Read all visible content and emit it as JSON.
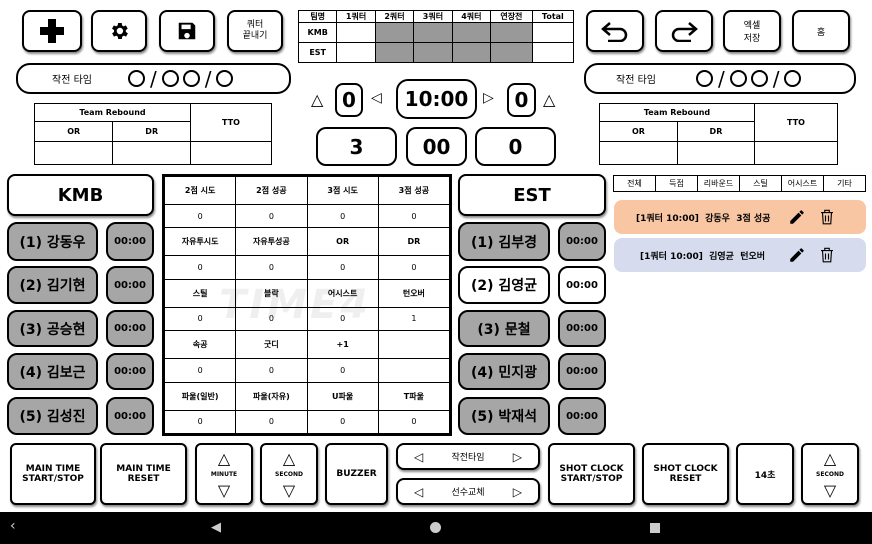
{
  "toolbar": {
    "add_icon": "plus-icon",
    "settings_icon": "gear-icon",
    "save_icon": "floppy-icon",
    "quarter_end_label": "쿼터\n끝내기",
    "undo_icon": "undo-icon",
    "redo_icon": "redo-icon",
    "excel_label": "엑셀\n저장",
    "home_label": "홈"
  },
  "quarter_table": {
    "headers": [
      "팀명",
      "1쿼터",
      "2쿼터",
      "3쿼터",
      "4쿼터",
      "연장전",
      "Total"
    ],
    "rows": [
      {
        "team": "KMB",
        "values": [
          "",
          "",
          "",
          "",
          "",
          ""
        ]
      },
      {
        "team": "EST",
        "values": [
          "",
          "",
          "",
          "",
          "",
          ""
        ]
      }
    ]
  },
  "left": {
    "timeout_label": "작전 타임",
    "team_rebound_label": "Team Rebound",
    "or_label": "OR",
    "dr_label": "DR",
    "tto_label": "TTO",
    "team_name": "KMB",
    "players": [
      {
        "name": "(1) 강동우",
        "time": "00:00"
      },
      {
        "name": "(2) 김기현",
        "time": "00:00"
      },
      {
        "name": "(3) 공승현",
        "time": "00:00"
      },
      {
        "name": "(4) 김보근",
        "time": "00:00"
      },
      {
        "name": "(5) 김성진",
        "time": "00:00"
      }
    ]
  },
  "right": {
    "timeout_label": "작전 타임",
    "team_rebound_label": "Team Rebound",
    "or_label": "OR",
    "dr_label": "DR",
    "tto_label": "TTO",
    "team_name": "EST",
    "players": [
      {
        "name": "(1) 김부경",
        "time": "00:00"
      },
      {
        "name": "(2) 김영균",
        "time": "00:00"
      },
      {
        "name": "(3) 문철",
        "time": "00:00"
      },
      {
        "name": "(4) 민지광",
        "time": "00:00"
      },
      {
        "name": "(5) 박재석",
        "time": "00:00"
      }
    ]
  },
  "scoreboard": {
    "left_foul": "0",
    "main_time": "10:00",
    "right_foul": "0",
    "left_score": "3",
    "shot_clock": "00",
    "right_score": "0"
  },
  "stats": {
    "rows": [
      {
        "labels": [
          "2점 시도",
          "2점 성공",
          "3점 시도",
          "3점 성공"
        ],
        "values": [
          "0",
          "0",
          "0",
          "0"
        ]
      },
      {
        "labels": [
          "자유투시도",
          "자유투성공",
          "OR",
          "DR"
        ],
        "values": [
          "0",
          "0",
          "0",
          "0"
        ]
      },
      {
        "labels": [
          "스틸",
          "블락",
          "어시스트",
          "턴오버"
        ],
        "values": [
          "0",
          "0",
          "0",
          "1"
        ]
      },
      {
        "labels": [
          "속공",
          "굿디",
          "+1",
          ""
        ],
        "values": [
          "0",
          "0",
          "0",
          ""
        ]
      },
      {
        "labels": [
          "파울(일반)",
          "파울(자유)",
          "U파울",
          "T파울"
        ],
        "values": [
          "0",
          "0",
          "0",
          "0"
        ]
      }
    ],
    "watermark": "TIME4"
  },
  "log": {
    "filters": [
      "전체",
      "득점",
      "리바운드",
      "스틸",
      "어시스트",
      "기타"
    ],
    "entries": [
      {
        "text": "[1쿼터 10:00]  강동우  3점 성공",
        "color": "#f9c6a4"
      },
      {
        "text": "[1쿼터 10:00]  김영균  턴오버",
        "color": "#d6dcee"
      }
    ]
  },
  "controls": {
    "main_time_start_stop": "MAIN TIME\nSTART/STOP",
    "main_time_reset": "MAIN TIME\nRESET",
    "minute_label": "MINUTE",
    "second_label": "SECOND",
    "buzzer": "BUZZER",
    "timeout_toggle": "작전타임",
    "substitution_toggle": "선수교체",
    "shot_clock_start_stop": "SHOT CLOCK\nSTART/STOP",
    "shot_clock_reset": "SHOT CLOCK\nRESET",
    "shot_14": "14초",
    "shot_second_label": "SECOND"
  }
}
